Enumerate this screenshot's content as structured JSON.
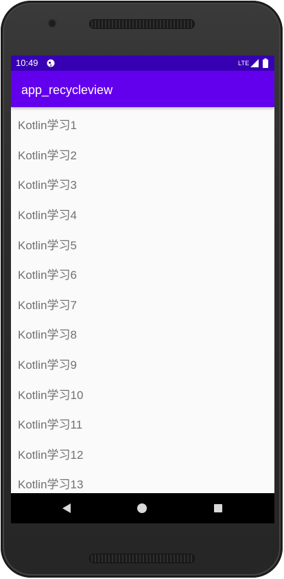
{
  "status_bar": {
    "time": "10:49",
    "network": "LTE",
    "icons": [
      "app-notification-icon",
      "signal-icon",
      "battery-icon"
    ]
  },
  "app_bar": {
    "title": "app_recycleview"
  },
  "list": {
    "items": [
      "Kotlin学习1",
      "Kotlin学习2",
      "Kotlin学习3",
      "Kotlin学习4",
      "Kotlin学习5",
      "Kotlin学习6",
      "Kotlin学习7",
      "Kotlin学习8",
      "Kotlin学习9",
      "Kotlin学习10",
      "Kotlin学习11",
      "Kotlin学习12",
      "Kotlin学习13"
    ]
  },
  "nav_bar": {
    "icons": [
      "back-icon",
      "home-icon",
      "recents-icon"
    ]
  },
  "colors": {
    "primary": "#6200ee",
    "primary_dark": "#3700b3",
    "list_background": "#fafafa",
    "list_text": "#707070",
    "nav_bar": "#000000"
  }
}
